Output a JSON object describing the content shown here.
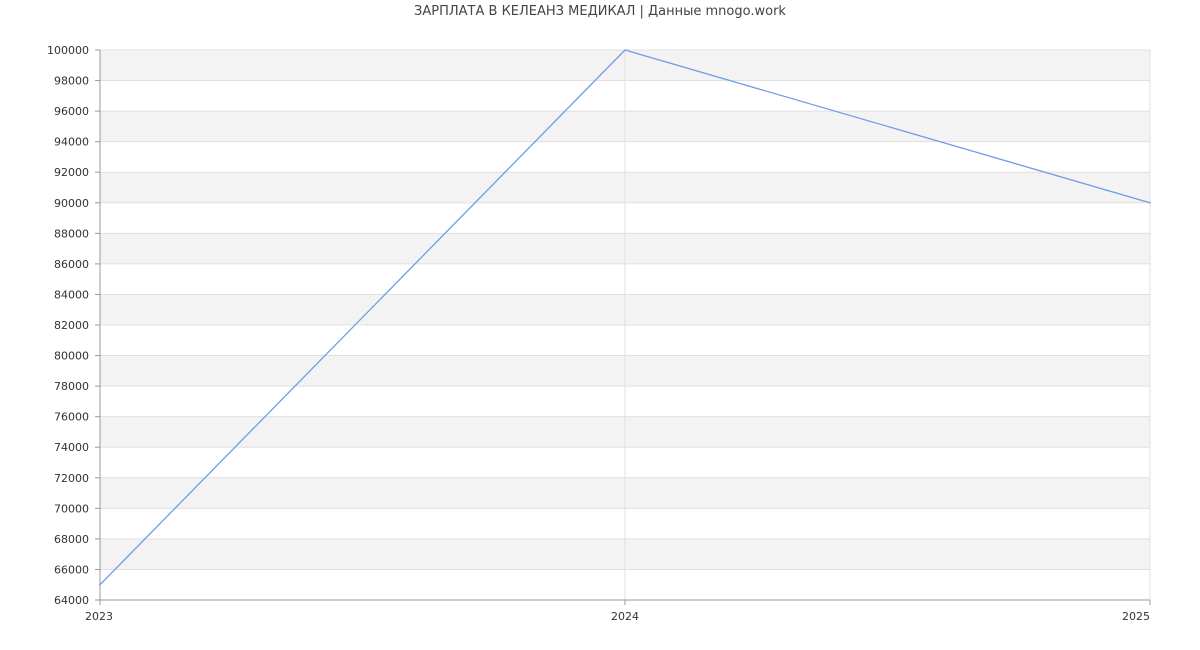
{
  "title": "ЗАРПЛАТА В КЕЛЕАНЗ МЕДИКАЛ | Данные mnogo.work",
  "colors": {
    "line": "#6f9ce8",
    "band": "#f3f3f3",
    "grid": "#e0e0e0",
    "axis": "#999999"
  },
  "chart_data": {
    "type": "line",
    "title": "ЗАРПЛАТА В КЕЛЕАНЗ МЕДИКАЛ | Данные mnogo.work",
    "xlabel": "",
    "ylabel": "",
    "x": [
      "2023",
      "2024",
      "2025"
    ],
    "series": [
      {
        "values": [
          65000,
          100000,
          90000
        ]
      }
    ],
    "ylim": [
      64000,
      100000
    ],
    "ytick_step": 2000,
    "grid": true,
    "legend": "none"
  }
}
